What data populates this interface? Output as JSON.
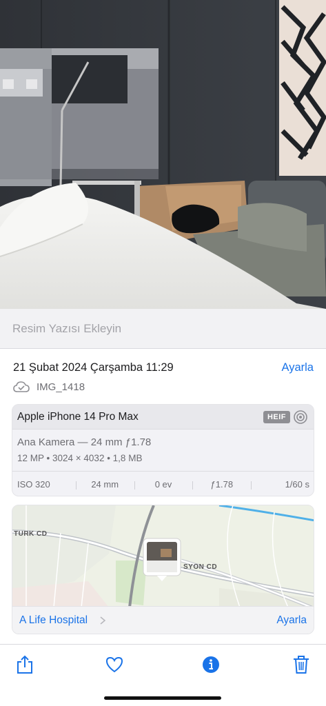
{
  "caption": {
    "placeholder": "Resim Yazısı Ekleyin"
  },
  "info": {
    "date": "21 Şubat 2024 Çarşamba 11:29",
    "adjust_label": "Ayarla",
    "filename": "IMG_1418"
  },
  "camera": {
    "device": "Apple iPhone 14 Pro Max",
    "format_badge": "HEIF",
    "lens": "Ana Kamera — 24 mm ƒ1.78",
    "specs": "12 MP • 3024 × 4032 • 1,8 MB",
    "exif": [
      "ISO 320",
      "24 mm",
      "0 ev",
      "ƒ1.78",
      "1/60 s"
    ]
  },
  "map": {
    "streets": [
      "TURK CD",
      "SYON CD"
    ],
    "place": "A Life Hospital",
    "adjust_label": "Ayarla"
  },
  "icons": [
    "share-icon",
    "heart-icon",
    "info-icon",
    "trash-icon"
  ],
  "colors": {
    "accent": "#1a73e8",
    "secondary_text": "#6d6d72"
  }
}
